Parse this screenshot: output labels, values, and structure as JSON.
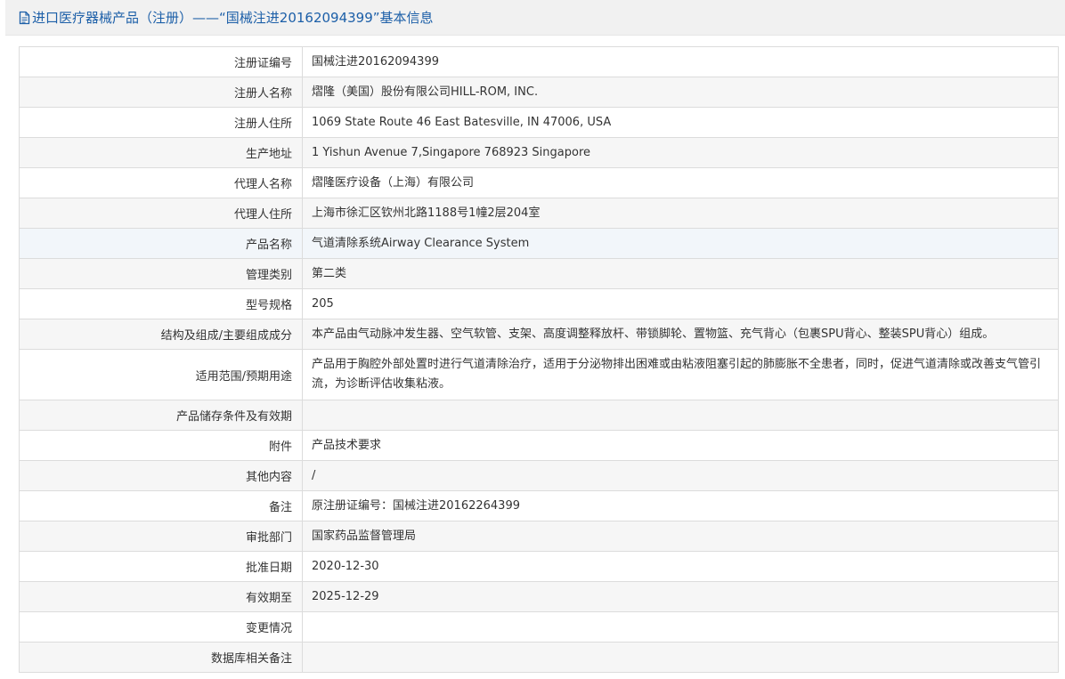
{
  "header": {
    "title": "进口医疗器械产品（注册）——“国械注进20162094399”基本信息",
    "icon": "document-icon",
    "accent_color": "#1c5fa8"
  },
  "rows": [
    {
      "label": "注册证编号",
      "value": "国械注进20162094399"
    },
    {
      "label": "注册人名称",
      "value": "熠隆（美国）股份有限公司HILL-ROM, INC."
    },
    {
      "label": "注册人住所",
      "value": "1069 State Route 46 East Batesville, IN 47006, USA"
    },
    {
      "label": "生产地址",
      "value": "1 Yishun Avenue 7,Singapore 768923 Singapore"
    },
    {
      "label": "代理人名称",
      "value": "熠隆医疗设备（上海）有限公司"
    },
    {
      "label": "代理人住所",
      "value": "上海市徐汇区钦州北路1188号1幢2层204室"
    },
    {
      "label": "产品名称",
      "value": "气道清除系统Airway Clearance System"
    },
    {
      "label": "管理类别",
      "value": "第二类"
    },
    {
      "label": "型号规格",
      "value": "205"
    },
    {
      "label": "结构及组成/主要组成成分",
      "value": "本产品由气动脉冲发生器、空气软管、支架、高度调整释放杆、带锁脚轮、置物篮、充气背心（包裹SPU背心、整装SPU背心）组成。"
    },
    {
      "label": "适用范围/预期用途",
      "value": "产品用于胸腔外部处置时进行气道清除治疗，适用于分泌物排出困难或由粘液阻塞引起的肺膨胀不全患者，同时，促进气道清除或改善支气管引流，为诊断评估收集粘液。"
    },
    {
      "label": "产品储存条件及有效期",
      "value": ""
    },
    {
      "label": "附件",
      "value": "产品技术要求"
    },
    {
      "label": "其他内容",
      "value": "/"
    },
    {
      "label": "备注",
      "value": "原注册证编号：国械注进20162264399"
    },
    {
      "label": "审批部门",
      "value": "国家药品监督管理局"
    },
    {
      "label": "批准日期",
      "value": "2020-12-30"
    },
    {
      "label": "有效期至",
      "value": "2025-12-29"
    },
    {
      "label": "变更情况",
      "value": ""
    },
    {
      "label": "数据库相关备注",
      "value": ""
    }
  ]
}
